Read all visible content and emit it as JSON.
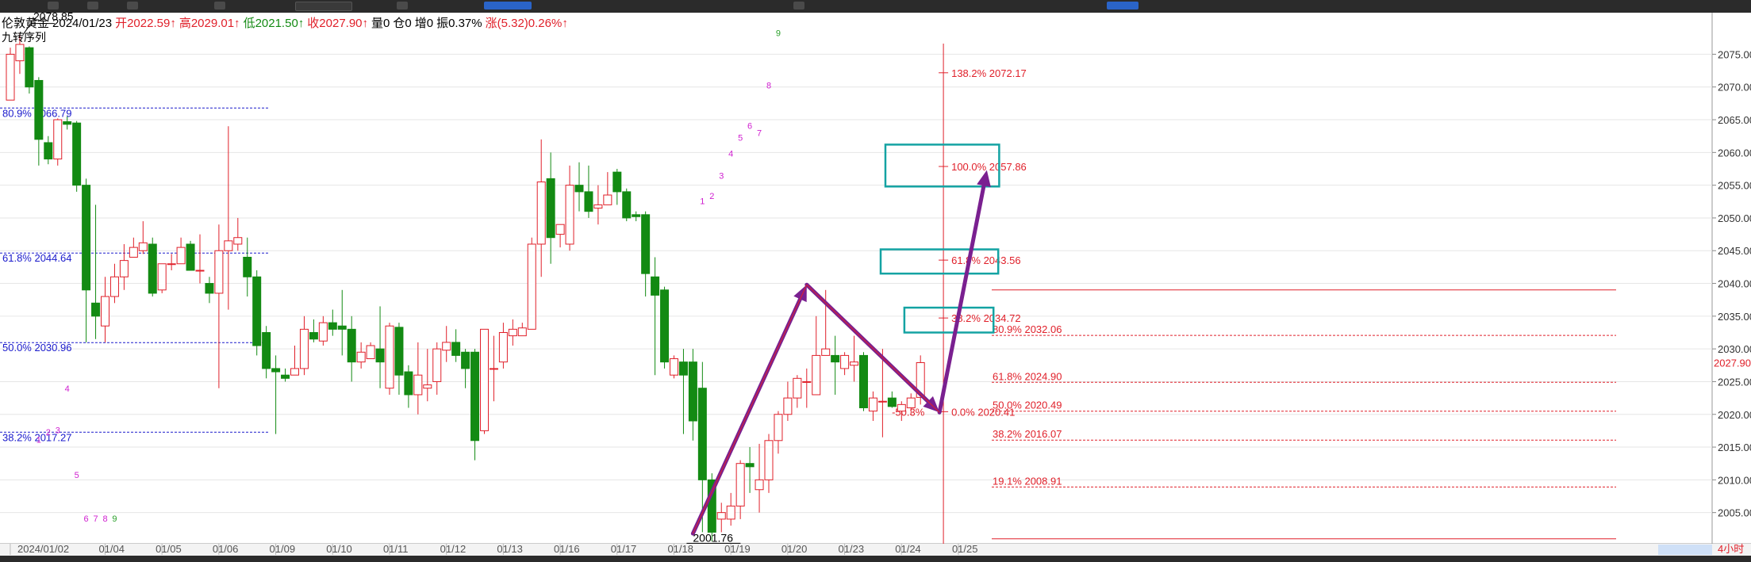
{
  "instrument": {
    "name": "伦敦黄金",
    "date": "2024/01/23",
    "open": "开2022.59↑",
    "high": "高2029.01↑",
    "low": "低2021.50↑",
    "close": "收2027.90↑",
    "volume": "量0",
    "position": "仓0",
    "increase": "增0",
    "amplitude": "振0.37%",
    "change": "涨(5.32)0.26%↑"
  },
  "indicator_name": "九转序列",
  "colors": {
    "up": "#e0202a",
    "down": "#138a13",
    "fib_blue": "#1a1acc",
    "fib_red": "#e0202a",
    "box": "#14a3a3",
    "arrow": "#7a2090",
    "seq": "#d020d0"
  },
  "chart_data": {
    "type": "candlestick",
    "ylim": [
      2000.6,
      2078.2
    ],
    "y_ticks": [
      "2075.00",
      "2070.00",
      "2065.00",
      "2060.00",
      "2055.00",
      "2050.00",
      "2045.00",
      "2040.00",
      "2035.00",
      "2030.00",
      "2025.00",
      "2020.00",
      "2015.00",
      "2010.00",
      "2005.00",
      "2000.00"
    ],
    "y_tick_values": [
      2075,
      2070,
      2065,
      2060,
      2055,
      2050,
      2045,
      2040,
      2035,
      2030,
      2025,
      2020,
      2015,
      2010,
      2005,
      2000
    ],
    "last_price": "2027.90",
    "last_price_value": 2027.9,
    "x_labels": [
      "2024/01/02",
      "01/04",
      "01/05",
      "01/06",
      "01/09",
      "01/10",
      "01/11",
      "01/12",
      "01/13",
      "01/16",
      "01/17",
      "01/18",
      "01/19",
      "01/20",
      "01/23",
      "01/24",
      "01/25"
    ],
    "x_label_index": [
      1,
      11,
      17,
      23,
      29,
      35,
      41,
      47,
      53,
      59,
      65,
      71,
      77,
      83,
      89,
      95,
      101
    ],
    "last_axis_label": "4小时",
    "candles": [
      [
        2068,
        2076,
        2075,
        2068
      ],
      [
        2074,
        2078.2,
        2076.5,
        2072
      ],
      [
        2076,
        2076.2,
        2070,
        2069
      ],
      [
        2071,
        2071.5,
        2062,
        2058
      ],
      [
        2061.5,
        2062.5,
        2059,
        2058.2
      ],
      [
        2059,
        2065.2,
        2065,
        2058
      ],
      [
        2064.7,
        2065.5,
        2064.3,
        2063.5
      ],
      [
        2064.5,
        2064.8,
        2055,
        2054
      ],
      [
        2055,
        2056,
        2039,
        2031
      ],
      [
        2037,
        2052,
        2035,
        2031.5
      ],
      [
        2033.5,
        2041,
        2038,
        2031
      ],
      [
        2038,
        2043,
        2041,
        2037
      ],
      [
        2041,
        2046,
        2043.5,
        2039
      ],
      [
        2044,
        2047,
        2045.5,
        2044
      ],
      [
        2045,
        2049.5,
        2046.2,
        2044.5
      ],
      [
        2046,
        2047,
        2038.5,
        2038
      ],
      [
        2039,
        2043,
        2043,
        2038.5
      ],
      [
        2043,
        2044.5,
        2043,
        2042
      ],
      [
        2043,
        2047,
        2045.5,
        2043
      ],
      [
        2046,
        2046.5,
        2042,
        2042
      ],
      [
        2042,
        2047.5,
        2042,
        2040
      ],
      [
        2040,
        2041,
        2038.5,
        2037
      ],
      [
        2038.5,
        2049,
        2045,
        2024
      ],
      [
        2045,
        2064,
        2046.5,
        2036
      ],
      [
        2046,
        2050,
        2047,
        2045
      ],
      [
        2044,
        2047,
        2041,
        2038
      ],
      [
        2041,
        2042,
        2030.5,
        2029
      ],
      [
        2032.5,
        2033.5,
        2027,
        2025.5
      ],
      [
        2027,
        2029,
        2026.5,
        2017
      ],
      [
        2026,
        2027,
        2025.5,
        2025
      ],
      [
        2026,
        2030.5,
        2027,
        2026
      ],
      [
        2027,
        2035,
        2033,
        2026
      ],
      [
        2032.5,
        2034.5,
        2031.5,
        2031
      ],
      [
        2031.2,
        2035,
        2034,
        2030.5
      ],
      [
        2034,
        2036,
        2033,
        2032
      ],
      [
        2033.5,
        2039,
        2033,
        2029
      ],
      [
        2033,
        2035,
        2028,
        2025
      ],
      [
        2028,
        2031,
        2029.5,
        2027
      ],
      [
        2028.5,
        2031,
        2030.5,
        2029
      ],
      [
        2030,
        2036.5,
        2028,
        2024
      ],
      [
        2024,
        2034,
        2033.5,
        2023
      ],
      [
        2033.3,
        2034,
        2026,
        2023
      ],
      [
        2026.5,
        2027.5,
        2023,
        2021
      ],
      [
        2023,
        2031,
        2026,
        2020
      ],
      [
        2024,
        2030,
        2024.5,
        2022
      ],
      [
        2025,
        2031,
        2030,
        2023
      ],
      [
        2029.8,
        2033.5,
        2031,
        2028
      ],
      [
        2031,
        2033,
        2029,
        2028
      ],
      [
        2029.5,
        2030,
        2027,
        2024
      ],
      [
        2029.5,
        2030,
        2016,
        2013
      ],
      [
        2017.5,
        2032,
        2033,
        2017
      ],
      [
        2027,
        2032,
        2027,
        2022
      ],
      [
        2028,
        2034,
        2032.5,
        2027
      ],
      [
        2032,
        2034.5,
        2033,
        2030.5
      ],
      [
        2032,
        2034,
        2033.2,
        2032
      ],
      [
        2033,
        2047,
        2046,
        2033
      ],
      [
        2046,
        2062,
        2055.5,
        2041
      ],
      [
        2056,
        2060,
        2047,
        2043
      ],
      [
        2047.5,
        2049,
        2049,
        2045.5
      ],
      [
        2046,
        2058,
        2055,
        2045
      ],
      [
        2055,
        2058.5,
        2054,
        2051
      ],
      [
        2054,
        2058,
        2051,
        2050
      ],
      [
        2051.5,
        2055,
        2052,
        2049
      ],
      [
        2052,
        2057,
        2053.5,
        2052
      ],
      [
        2057,
        2057.5,
        2054,
        2052
      ],
      [
        2054,
        2054.5,
        2050,
        2049.5
      ],
      [
        2050.5,
        2051,
        2050.2,
        2049.5
      ],
      [
        2050.5,
        2051,
        2041.5,
        2038
      ],
      [
        2041,
        2044,
        2038.2,
        2026
      ],
      [
        2039,
        2039.5,
        2028,
        2027
      ],
      [
        2026,
        2029,
        2028.5,
        2025.5
      ],
      [
        2028,
        2030,
        2026,
        2017
      ],
      [
        2028,
        2030,
        2019,
        2016
      ],
      [
        2024,
        2028,
        2010,
        2002
      ],
      [
        2010,
        2011,
        2002,
        2000.6
      ],
      [
        2004,
        2006.5,
        2005,
        2002
      ],
      [
        2004,
        2008,
        2006,
        2003
      ],
      [
        2006,
        2013,
        2012.5,
        2004
      ],
      [
        2012.5,
        2015,
        2012,
        2008
      ],
      [
        2008.5,
        2015.5,
        2010,
        2005
      ],
      [
        2010,
        2017,
        2016,
        2008
      ],
      [
        2016,
        2020.5,
        2020,
        2014
      ],
      [
        2020,
        2025,
        2022.5,
        2019
      ],
      [
        2022.5,
        2026,
        2025.5,
        2021
      ],
      [
        2025,
        2027,
        2025,
        2021
      ],
      [
        2023,
        2035,
        2029,
        2023
      ],
      [
        2029,
        2039,
        2030,
        2030
      ],
      [
        2029,
        2032,
        2028,
        2023
      ],
      [
        2027,
        2029.5,
        2029,
        2026
      ],
      [
        2027.5,
        2032,
        2028,
        2025
      ],
      [
        2029,
        2029.5,
        2021,
        2020.5
      ],
      [
        2020.5,
        2023.5,
        2022.5,
        2019
      ],
      [
        2022,
        2030,
        2022,
        2016.5
      ],
      [
        2022.5,
        2023.5,
        2021.2,
        2021
      ],
      [
        2020.5,
        2022,
        2021.5,
        2019
      ],
      [
        2021,
        2023.2,
        2022.5,
        2020
      ],
      [
        2022.59,
        2029.01,
        2027.9,
        2021.5
      ]
    ],
    "fib_left": [
      {
        "label": "80.9% 2066.79",
        "value": 2066.79
      },
      {
        "label": "61.8% 2044.64",
        "value": 2044.64
      },
      {
        "label": "50.0% 2030.96",
        "value": 2030.96
      },
      {
        "label": "38.2% 2017.27",
        "value": 2017.27
      }
    ],
    "fib_mid": [
      {
        "label": "80.9% 2032.06",
        "value": 2032.06
      },
      {
        "label": "61.8% 2024.90",
        "value": 2024.9
      },
      {
        "label": "50.0% 2020.49",
        "value": 2020.49
      },
      {
        "label": "38.2% 2016.07",
        "value": 2016.07
      },
      {
        "label": "19.1% 2008.91",
        "value": 2008.91
      }
    ],
    "fib_top_line": 2039.0,
    "fib_bottom_line": 2001.0,
    "fib_right": [
      {
        "label": "138.2% 2072.17",
        "value": 2072.17
      },
      {
        "label": "100.0% 2057.86",
        "value": 2057.86
      },
      {
        "label": "61.8% 2043.56",
        "value": 2043.56
      },
      {
        "label": "38.2% 2034.72",
        "value": 2034.72
      },
      {
        "label": "-50.3%",
        "value": 2020.41
      },
      {
        "label": "0.0% 2020.41",
        "value": 2020.41
      }
    ],
    "annotations": {
      "high_label": "2078.85",
      "high_value": 2078.0,
      "low_label": "2001.76",
      "low_value": 2001.76
    },
    "vline_index": 98,
    "arrows": [
      {
        "from": [
          72,
          2001.8
        ],
        "to": [
          84,
          2039.8
        ]
      },
      {
        "from": [
          84,
          2039.8
        ],
        "to": [
          98,
          2020.3
        ]
      },
      {
        "from": [
          98,
          2020.3
        ],
        "to": [
          103,
          2057.3
        ]
      }
    ],
    "boxes": [
      {
        "i0": 92.3,
        "i1": 104.3,
        "y0": 2054.8,
        "y1": 2061.2
      },
      {
        "i0": 91.8,
        "i1": 104.2,
        "y0": 2041.5,
        "y1": 2045.2
      },
      {
        "i0": 94.3,
        "i1": 103.7,
        "y0": 2032.5,
        "y1": 2036.3
      }
    ],
    "seq": [
      {
        "t": "1",
        "i": 3,
        "v": 2015.7
      },
      {
        "t": "2",
        "i": 4,
        "v": 2016.8
      },
      {
        "t": "3",
        "i": 5,
        "v": 2017.1
      },
      {
        "t": "4",
        "i": 6,
        "v": 2023.5
      },
      {
        "t": "5",
        "i": 7,
        "v": 2010.3
      },
      {
        "t": "6",
        "i": 8,
        "v": 2003.6
      },
      {
        "t": "7",
        "i": 9,
        "v": 2003.6
      },
      {
        "t": "8",
        "i": 10,
        "v": 2003.6
      },
      {
        "t": "9",
        "i": 11,
        "v": 2003.6
      },
      {
        "t": "1",
        "i": 73,
        "v": 2052.1
      },
      {
        "t": "2",
        "i": 74,
        "v": 2052.9
      },
      {
        "t": "3",
        "i": 75,
        "v": 2056.0
      },
      {
        "t": "4",
        "i": 76,
        "v": 2059.4
      },
      {
        "t": "5",
        "i": 77,
        "v": 2061.8
      },
      {
        "t": "6",
        "i": 78,
        "v": 2063.6
      },
      {
        "t": "7",
        "i": 79,
        "v": 2062.5
      },
      {
        "t": "8",
        "i": 80,
        "v": 2069.8
      },
      {
        "t": "9",
        "i": 81,
        "v": 2077.8
      }
    ]
  }
}
